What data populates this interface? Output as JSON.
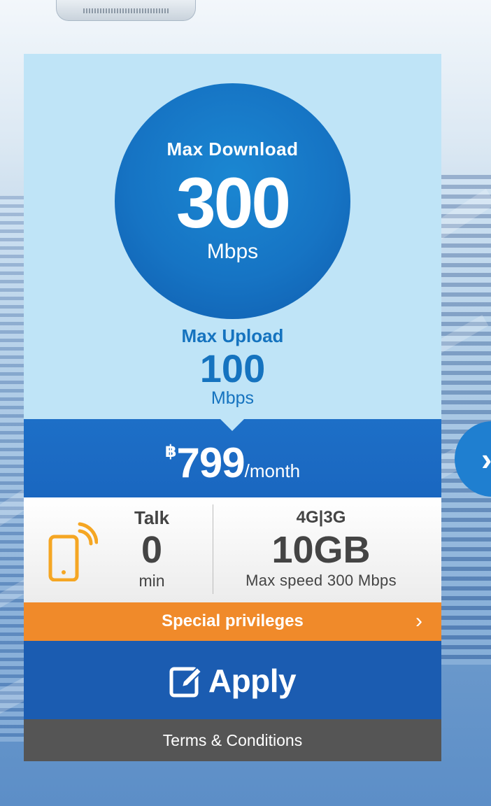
{
  "router": {
    "icon": "wifi-router-icon"
  },
  "plan": {
    "download": {
      "label": "Max Download",
      "value": "300",
      "unit": "Mbps"
    },
    "upload": {
      "label": "Max Upload",
      "value": "100",
      "unit": "Mbps"
    },
    "price": {
      "currency": "฿",
      "amount": "799",
      "period": "/month"
    },
    "talk": {
      "label": "Talk",
      "value": "0",
      "unit": "min",
      "icon": "mobile-phone-signal-icon"
    },
    "data": {
      "label": "4G|3G",
      "value": "10GB",
      "sub": "Max speed 300 Mbps"
    }
  },
  "actions": {
    "privileges_label": "Special privileges",
    "privileges_icon": "chevron-right-icon",
    "apply_label": "Apply",
    "apply_icon": "edit-icon",
    "terms_label": "Terms & Conditions"
  },
  "carousel": {
    "next_icon": "chevron-right-icon"
  },
  "colors": {
    "card_bg": "#bfe4f7",
    "primary_blue": "#1674c4",
    "apply_blue": "#1b5cb1",
    "accent_orange": "#f08a2a",
    "phone_icon": "#f5a623",
    "terms_gray": "#555555"
  }
}
